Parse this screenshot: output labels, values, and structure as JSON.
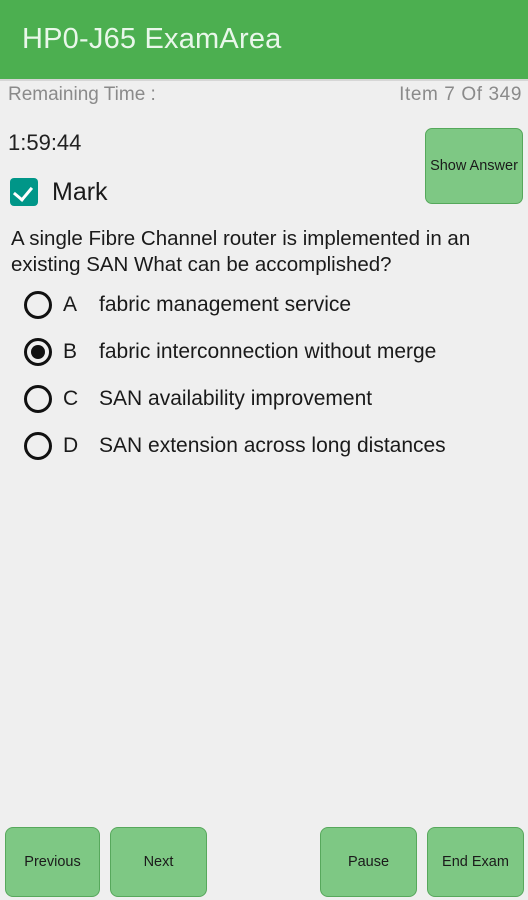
{
  "header": {
    "title": "HP0-J65 ExamArea",
    "background_color": "#4caf50",
    "title_color": "#e9f7ea"
  },
  "status": {
    "remaining_time_label": "Remaining Time :",
    "item_counter": "Item 7 Of 349",
    "timer_value": "1:59:44"
  },
  "mark": {
    "label": "Mark",
    "checked": true,
    "checkbox_color": "#009688"
  },
  "actions": {
    "show_answer_label": "Show Answer"
  },
  "question": {
    "text": "A single Fibre Channel router is implemented in an existing SAN What can be accomplished?",
    "options": [
      {
        "letter": "A",
        "text": "fabric management service",
        "selected": false
      },
      {
        "letter": "B",
        "text": "fabric interconnection without merge",
        "selected": true
      },
      {
        "letter": "C",
        "text": "SAN availability improvement",
        "selected": false
      },
      {
        "letter": "D",
        "text": "SAN extension across long distances",
        "selected": false
      }
    ]
  },
  "bottom_bar": {
    "previous_label": "Previous",
    "next_label": "Next",
    "pause_label": "Pause",
    "end_exam_label": "End Exam",
    "button_color": "#7ec884"
  }
}
